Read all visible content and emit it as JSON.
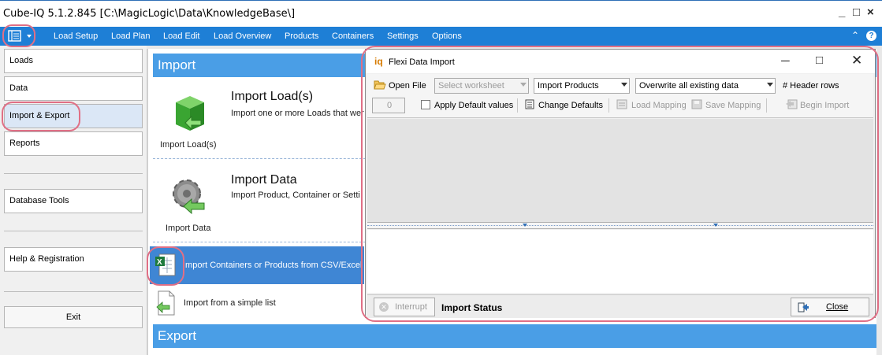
{
  "window": {
    "title": "Cube-IQ  5.1.2.845  [C:\\MagicLogic\\Data\\KnowledgeBase\\]",
    "minimize": "_",
    "maximize": "□",
    "close": "×"
  },
  "menu": {
    "items": [
      "Load Setup",
      "Load Plan",
      "Load Edit",
      "Load Overview",
      "Products",
      "Containers",
      "Settings",
      "Options"
    ],
    "collapse_glyph": "⌃",
    "help_glyph": "?"
  },
  "nav": {
    "items": [
      "Loads",
      "Data",
      "Import & Export",
      "Reports",
      "Database Tools",
      "Help & Registration"
    ],
    "exit": "Exit"
  },
  "content": {
    "import_header": "Import",
    "export_header": "Export",
    "tile1_title": "Import Load(s)",
    "tile1_desc": "Import one or more Loads that wer",
    "tile1_caption": "Import Load(s)",
    "tile2_title": "Import Data",
    "tile2_desc": "Import Product, Container or Setti",
    "tile2_caption": "Import Data",
    "row1": "Import Containers or Products from CSV/Excel",
    "row2": "Import from a simple list"
  },
  "dialog": {
    "title": "Flexi Data Import",
    "icon_text": "iq",
    "open_file": "Open File",
    "worksheet_placeholder": "Select worksheet",
    "import_type": "Import Products",
    "overwrite_mode": "Overwrite all existing data",
    "header_rows_label": "# Header rows",
    "header_rows_value": "0",
    "apply_defaults": "Apply Default values",
    "change_defaults": "Change Defaults",
    "load_mapping": "Load Mapping",
    "save_mapping": "Save Mapping",
    "begin_import": "Begin Import",
    "interrupt": "Interrupt",
    "status_label": "Import Status",
    "close": "Close"
  },
  "colors": {
    "menu_bg": "#1e7fd6",
    "section_header": "#4a9ee6",
    "selected_row": "#3f86d4",
    "highlight_ring": "#e06f85"
  }
}
